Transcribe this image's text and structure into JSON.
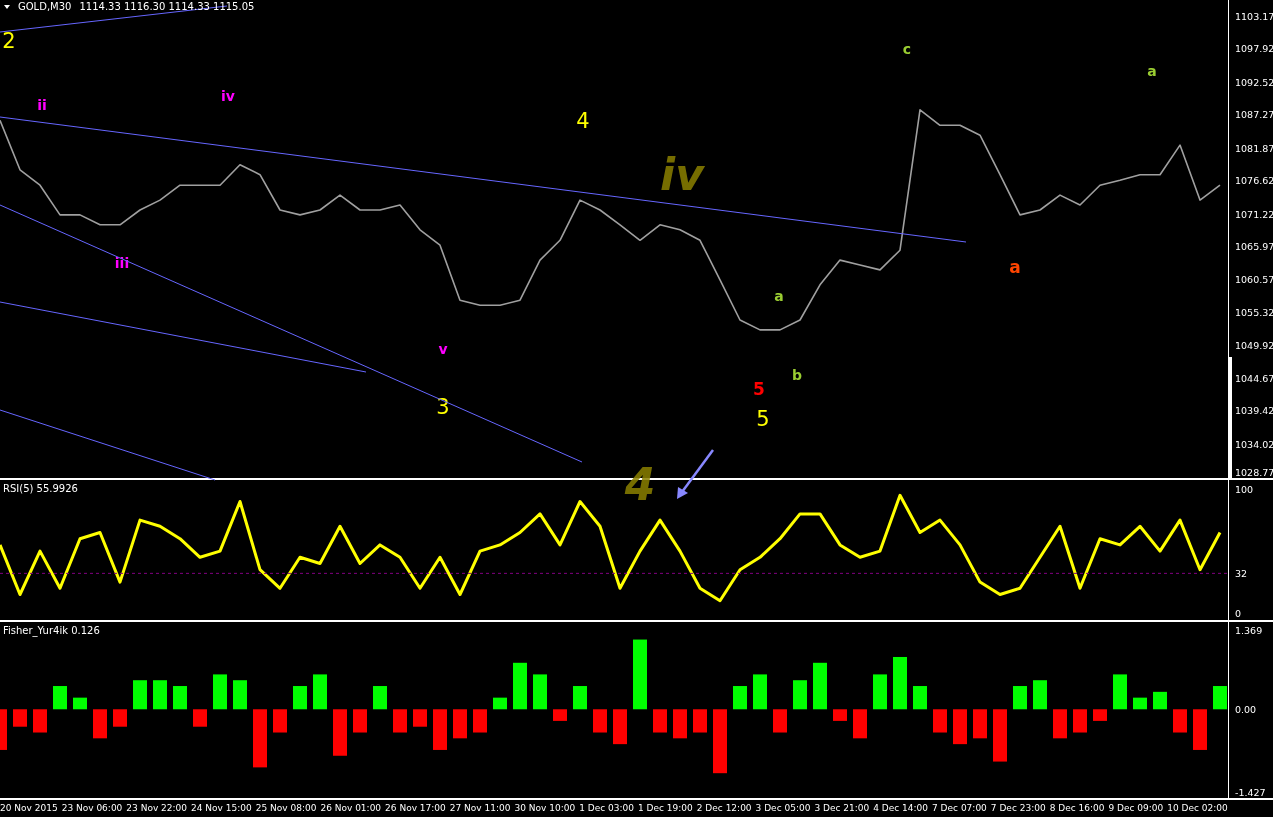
{
  "header": {
    "symbol": "GOLD,M30",
    "quote": "1114.33 1116.30 1114.33 1115.05"
  },
  "price_panel": {
    "chart_data": {
      "type": "line",
      "series": [
        {
          "color": "#a0a0a0",
          "values": [
            1086.3,
            1078.3,
            1075.8,
            1071.0,
            1071.0,
            1069.4,
            1069.4,
            1071.8,
            1073.4,
            1075.8,
            1075.8,
            1075.8,
            1079.1,
            1077.5,
            1071.8,
            1071.0,
            1071.8,
            1074.2,
            1071.8,
            1071.8,
            1072.6,
            1068.6,
            1066.1,
            1057.2,
            1056.4,
            1056.4,
            1057.2,
            1063.7,
            1066.9,
            1073.4,
            1071.8,
            1069.4,
            1066.9,
            1069.4,
            1068.6,
            1066.9,
            1060.5,
            1054.0,
            1052.4,
            1052.4,
            1054.0,
            1059.7,
            1063.7,
            1062.9,
            1062.1,
            1065.3,
            1088.0,
            1085.5,
            1085.5,
            1083.9,
            1077.5,
            1071.0,
            1071.8,
            1074.2,
            1072.6,
            1075.8,
            1076.6,
            1077.5,
            1077.5,
            1082.3,
            1073.4,
            1075.8
          ]
        }
      ],
      "ylim": [
        1028.45,
        1105.76
      ],
      "yticks": [
        1103.17,
        1097.92,
        1092.52,
        1087.27,
        1081.87,
        1076.62,
        1071.22,
        1065.97,
        1060.57,
        1055.32,
        1049.92,
        1044.67,
        1039.42,
        1034.02,
        1028.77
      ]
    },
    "wave_labels": [
      {
        "text": "2",
        "color": "#ffff00",
        "kind": "major"
      },
      {
        "text": "ii",
        "color": "#ff00ff",
        "kind": "minor"
      },
      {
        "text": "iv",
        "color": "#ff00ff",
        "kind": "minor"
      },
      {
        "text": "iii",
        "color": "#ff00ff",
        "kind": "minor"
      },
      {
        "text": "v",
        "color": "#ff00ff",
        "kind": "minor"
      },
      {
        "text": "4",
        "color": "#ffff00",
        "kind": "major"
      },
      {
        "text": "3",
        "color": "#ffff00",
        "kind": "major"
      },
      {
        "text": "5",
        "color": "#ff0000",
        "kind": "bold"
      },
      {
        "text": "5",
        "color": "#ffff00",
        "kind": "major"
      },
      {
        "text": "a",
        "color": "#9acd32",
        "kind": "minor"
      },
      {
        "text": "b",
        "color": "#9acd32",
        "kind": "minor"
      },
      {
        "text": "c",
        "color": "#9acd32",
        "kind": "minor"
      },
      {
        "text": "a",
        "color": "#ff4500",
        "kind": "bold"
      },
      {
        "text": "a",
        "color": "#9acd32",
        "kind": "minor"
      }
    ]
  },
  "handwritten_marks": [
    {
      "text": "iv"
    },
    {
      "text": "4"
    }
  ],
  "rsi_panel": {
    "title": "RSI(5) 55.9926",
    "chart_data": {
      "type": "line",
      "series": [
        {
          "color": "#ffff00",
          "values": [
            55,
            15,
            50,
            20,
            60,
            65,
            25,
            75,
            70,
            60,
            45,
            50,
            90,
            35,
            20,
            45,
            40,
            70,
            40,
            55,
            45,
            20,
            45,
            15,
            50,
            55,
            65,
            80,
            55,
            90,
            70,
            20,
            50,
            75,
            50,
            20,
            10,
            35,
            45,
            60,
            80,
            80,
            55,
            45,
            50,
            95,
            65,
            75,
            55,
            25,
            15,
            20,
            45,
            70,
            20,
            60,
            55,
            70,
            50,
            75,
            35,
            65
          ]
        }
      ],
      "ylim": [
        -5.6,
        107.3
      ],
      "yticks": [
        0,
        32,
        100
      ]
    }
  },
  "fisher_panel": {
    "title": "Fisher_Yur4ik 0.126",
    "chart_data": {
      "type": "bar",
      "series": [
        {
          "color": "#00ff00",
          "values": [
            null,
            null,
            null,
            0.4,
            0.2,
            null,
            null,
            0.5,
            0.5,
            0.4,
            null,
            0.6,
            0.5,
            null,
            null,
            0.4,
            0.6,
            null,
            null,
            0.4,
            null,
            null,
            null,
            null,
            null,
            0.2,
            0.8,
            0.6,
            null,
            0.4,
            null,
            null,
            1.2,
            null,
            null,
            null,
            null,
            0.4,
            0.6,
            null,
            0.5,
            0.8,
            null,
            null,
            0.6,
            0.9,
            0.4,
            null,
            null,
            null,
            null,
            0.4,
            0.5,
            null,
            null,
            null,
            0.6,
            0.2,
            0.3,
            null,
            null,
            0.4
          ]
        },
        {
          "color": "#ff0000",
          "values": [
            -0.7,
            -0.3,
            -0.4,
            null,
            null,
            -0.5,
            -0.3,
            null,
            null,
            null,
            -0.3,
            null,
            null,
            -1.0,
            -0.4,
            null,
            null,
            -0.8,
            -0.4,
            null,
            -0.4,
            -0.3,
            -0.7,
            -0.5,
            -0.4,
            null,
            null,
            null,
            -0.2,
            null,
            -0.4,
            -0.6,
            null,
            -0.4,
            -0.5,
            -0.4,
            -1.1,
            null,
            null,
            -0.4,
            null,
            null,
            -0.2,
            -0.5,
            null,
            null,
            null,
            -0.4,
            -0.6,
            -0.5,
            -0.9,
            null,
            null,
            -0.5,
            -0.4,
            -0.2,
            null,
            null,
            null,
            -0.4,
            -0.7,
            null
          ]
        }
      ],
      "stacked": true,
      "ylim": [
        -1.527,
        1.502
      ],
      "yticks": [
        -1.427,
        {
          "value": 0,
          "label": "0.00"
        },
        1.369
      ]
    }
  },
  "time_axis": [
    "20 Nov 2015",
    "23 Nov 06:00",
    "23 Nov 22:00",
    "24 Nov 15:00",
    "25 Nov 08:00",
    "26 Nov 01:00",
    "26 Nov 17:00",
    "27 Nov 11:00",
    "30 Nov 10:00",
    "1 Dec 03:00",
    "1 Dec 19:00",
    "2 Dec 12:00",
    "3 Dec 05:00",
    "3 Dec 21:00",
    "4 Dec 14:00",
    "7 Dec 07:00",
    "7 Dec 23:00",
    "8 Dec 16:00",
    "9 Dec 09:00",
    "10 Dec 02:00"
  ]
}
